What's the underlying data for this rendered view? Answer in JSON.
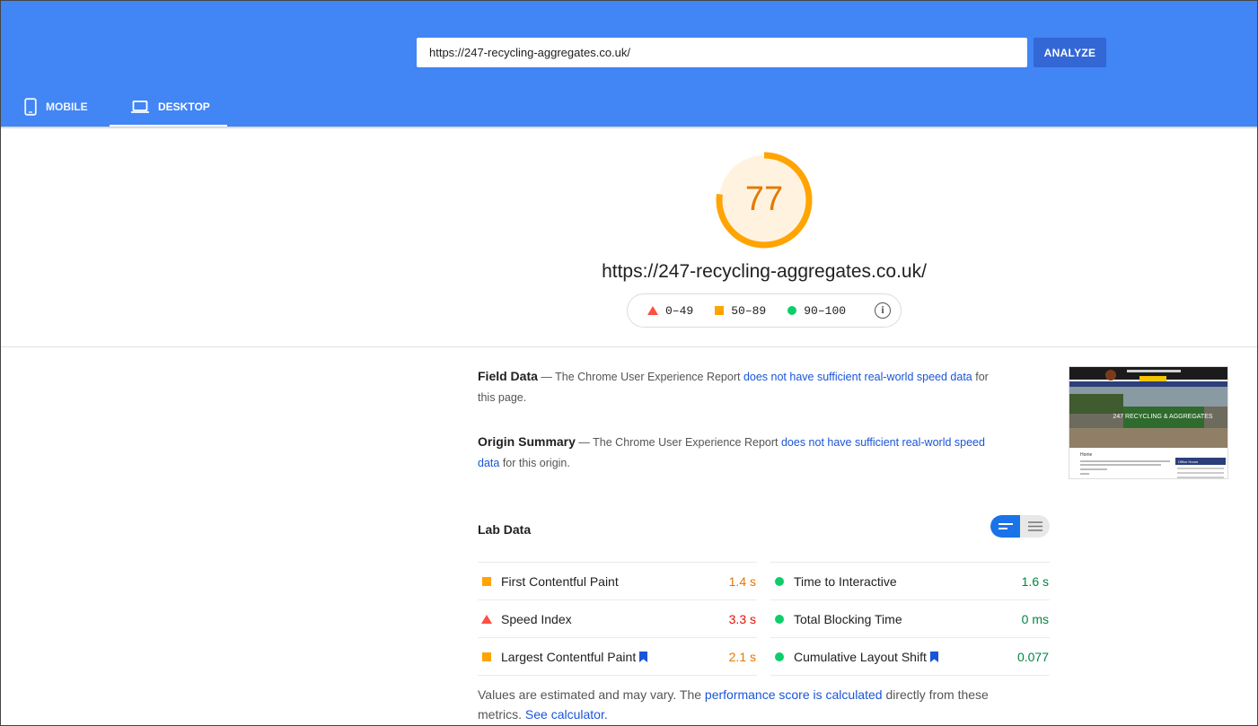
{
  "search": {
    "url_value": "https://247-recycling-aggregates.co.uk/",
    "analyze_label": "ANALYZE"
  },
  "tabs": [
    {
      "label": "MOBILE",
      "icon": "smartphone-icon",
      "active": false
    },
    {
      "label": "DESKTOP",
      "icon": "laptop-icon",
      "active": true
    }
  ],
  "score": {
    "value": "77",
    "fraction": 0.77,
    "color": "#ffa400",
    "page_url": "https://247-recycling-aggregates.co.uk/"
  },
  "legend": {
    "fail": "0–49",
    "average": "50–89",
    "pass": "90–100",
    "info_glyph": "i"
  },
  "field_data": {
    "label": "Field Data",
    "dash": " — ",
    "text": "The Chrome User Experience Report ",
    "link": "does not have sufficient real-world speed data",
    "suffix": " for this page."
  },
  "origin_summary": {
    "label": "Origin Summary",
    "dash": " — ",
    "text": "The Chrome User Experience Report ",
    "link": "does not have sufficient real-world speed data",
    "suffix": " for this origin."
  },
  "lab_data": {
    "title": "Lab Data",
    "metrics": [
      {
        "name": "First Contentful Paint",
        "value": "1.4 s",
        "status": "average",
        "bookmark": false
      },
      {
        "name": "Time to Interactive",
        "value": "1.6 s",
        "status": "pass",
        "bookmark": false
      },
      {
        "name": "Speed Index",
        "value": "3.3 s",
        "status": "fail",
        "bookmark": false
      },
      {
        "name": "Total Blocking Time",
        "value": "0 ms",
        "status": "pass",
        "bookmark": false
      },
      {
        "name": "Largest Contentful Paint",
        "value": "2.1 s",
        "status": "average",
        "bookmark": true
      },
      {
        "name": "Cumulative Layout Shift",
        "value": "0.077",
        "status": "pass",
        "bookmark": true
      }
    ]
  },
  "note": {
    "pre": "Values are estimated and may vary. The ",
    "link1": "performance score is calculated",
    "mid": " directly from these metrics. ",
    "link2": "See calculator."
  },
  "thumbnail": {
    "hero_text": "247 RECYCLING & AGGREGATES",
    "heading": "Home",
    "sidebar_heading": "Office Hours"
  },
  "colors": {
    "header": "#4285f4",
    "fail": "#ff4e42",
    "average": "#ffa400",
    "pass": "#0cce6b",
    "link": "#1a55d8"
  }
}
